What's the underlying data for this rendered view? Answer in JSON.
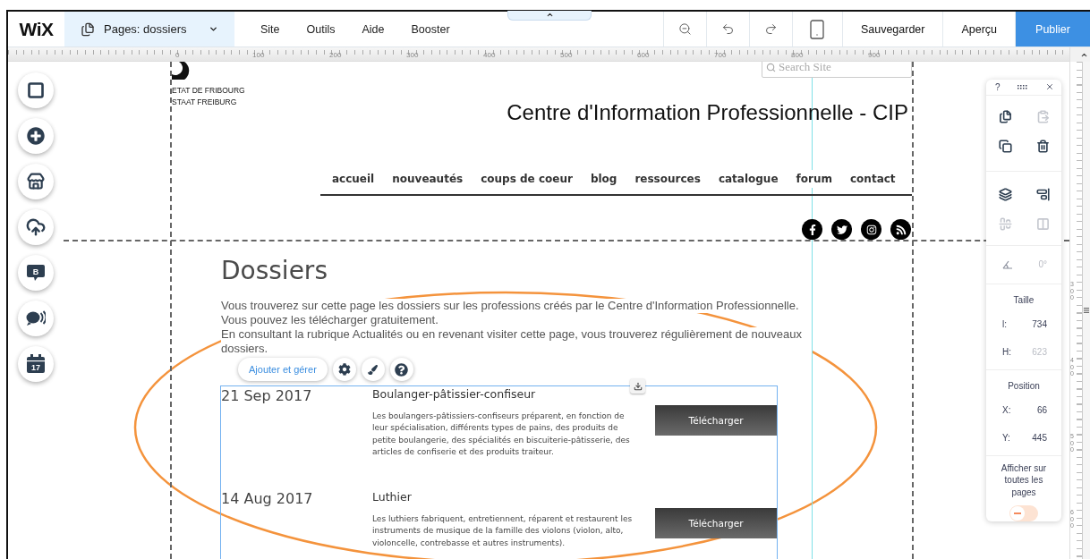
{
  "topbar": {
    "logo": "WiX",
    "pages_dropdown": {
      "label": "Pages: dossiers"
    },
    "menu": [
      "Site",
      "Outils",
      "Aide",
      "Booster"
    ],
    "actions": [
      {
        "label": "Sauvegarder",
        "kind": "plain"
      },
      {
        "label": "Aperçu",
        "kind": "plain"
      },
      {
        "label": "Publier",
        "kind": "primary"
      }
    ]
  },
  "ruler": {
    "labels": [
      "0",
      "100",
      "200",
      "300",
      "400",
      "500",
      "600",
      "700",
      "800",
      "900"
    ]
  },
  "vertical_ruler": {
    "labels": [
      "300",
      "400",
      "500",
      "600"
    ]
  },
  "left_tools": [
    {
      "kind": "background"
    },
    {
      "kind": "add"
    },
    {
      "kind": "store"
    },
    {
      "kind": "upload"
    },
    {
      "kind": "blog",
      "letter": "B"
    },
    {
      "kind": "chat"
    },
    {
      "kind": "events",
      "day": "17"
    }
  ],
  "site": {
    "logo_lines": [
      "ETAT DE FRIBOURG",
      "STAAT FREIBURG"
    ],
    "title": "Centre d'Information Professionnelle - CIP",
    "search": {
      "placeholder": "Search Site"
    },
    "nav": [
      "accueil",
      "nouveautés",
      "coups de coeur",
      "blog",
      "ressources",
      "catalogue",
      "forum",
      "contact"
    ],
    "social": [
      {
        "kind": "facebook"
      },
      {
        "kind": "twitter"
      },
      {
        "kind": "instagram"
      },
      {
        "kind": "rss"
      }
    ],
    "heading": "Dossiers",
    "intro": [
      "Vous trouverez sur cette page les dossiers sur les professions créés par le Centre d'Information Professionnelle.",
      "Vous pouvez les télécharger gratuitement.",
      "En consultant la rubrique Actualités ou en revenant visiter cette page, vous trouverez régulièrement de nouveaux dossiers."
    ]
  },
  "editor_toolbar": {
    "button": "Ajouter et gérer"
  },
  "dossiers": [
    {
      "date": "21 Sep 2017",
      "title": "Boulanger-pâtissier-confiseur",
      "description": "Les boulangers-pâtissiers-confiseurs préparent, en fonction de leur spécialisation, différents types de pains, des produits de petite boulangerie, des spécialités en biscuiterie-pâtisserie, des articles de confiserie et des produits traiteur.",
      "button": "Télécharger"
    },
    {
      "date": "14 Aug 2017",
      "title": "Luthier",
      "description": "Les luthiers fabriquent, entretiennent, réparent et restaurent les instruments de musique de la famille des violons (violon, alto, violoncelle, contrebasse et autres instruments).",
      "button": "Télécharger"
    }
  ],
  "inspector": {
    "help": "?",
    "actions": [
      {
        "kind": "duplicate",
        "disabled": false
      },
      {
        "kind": "paste",
        "disabled": true
      },
      {
        "kind": "copy",
        "disabled": false
      },
      {
        "kind": "delete",
        "disabled": false
      }
    ],
    "arrange": [
      {
        "kind": "arrange",
        "disabled": false
      },
      {
        "kind": "align",
        "disabled": false
      },
      {
        "kind": "distribute",
        "disabled": true
      },
      {
        "kind": "match",
        "disabled": true
      }
    ],
    "rotation": {
      "value": "0°",
      "disabled": true
    },
    "size": {
      "heading": "Taille",
      "fields": [
        {
          "label": "l:",
          "value": "734",
          "disabled": false
        },
        {
          "label": "H:",
          "value": "623",
          "disabled": true
        }
      ]
    },
    "position": {
      "heading": "Position",
      "fields": [
        {
          "label": "X:",
          "value": "66",
          "disabled": false
        },
        {
          "label": "Y:",
          "value": "445",
          "disabled": false
        }
      ]
    },
    "show_all_pages": {
      "label": "Afficher sur toutes les pages",
      "on": false
    }
  }
}
